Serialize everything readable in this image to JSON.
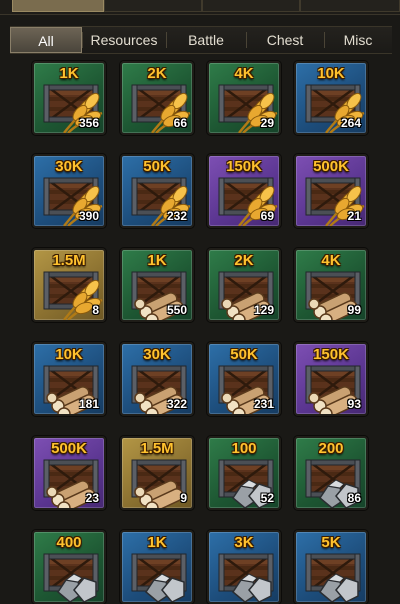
{
  "filter_tabs": [
    "All",
    "Resources",
    "Battle",
    "Chest",
    "Misc"
  ],
  "active_filter": "All",
  "rarity_colors": {
    "green": "#2f7c49",
    "blue": "#2d6fa8",
    "purple": "#7d4fb3",
    "gold": "#b39645"
  },
  "items": [
    {
      "amount": "1K",
      "count": "356",
      "rarity": "green",
      "resource": "wheat"
    },
    {
      "amount": "2K",
      "count": "66",
      "rarity": "green",
      "resource": "wheat"
    },
    {
      "amount": "4K",
      "count": "29",
      "rarity": "green",
      "resource": "wheat"
    },
    {
      "amount": "10K",
      "count": "264",
      "rarity": "blue",
      "resource": "wheat"
    },
    {
      "amount": "30K",
      "count": "390",
      "rarity": "blue",
      "resource": "wheat"
    },
    {
      "amount": "50K",
      "count": "232",
      "rarity": "blue",
      "resource": "wheat"
    },
    {
      "amount": "150K",
      "count": "69",
      "rarity": "purple",
      "resource": "wheat"
    },
    {
      "amount": "500K",
      "count": "21",
      "rarity": "purple",
      "resource": "wheat"
    },
    {
      "amount": "1.5M",
      "count": "8",
      "rarity": "gold",
      "resource": "wheat"
    },
    {
      "amount": "1K",
      "count": "550",
      "rarity": "green",
      "resource": "wood"
    },
    {
      "amount": "2K",
      "count": "129",
      "rarity": "green",
      "resource": "wood"
    },
    {
      "amount": "4K",
      "count": "99",
      "rarity": "green",
      "resource": "wood"
    },
    {
      "amount": "10K",
      "count": "181",
      "rarity": "blue",
      "resource": "wood"
    },
    {
      "amount": "30K",
      "count": "322",
      "rarity": "blue",
      "resource": "wood"
    },
    {
      "amount": "50K",
      "count": "231",
      "rarity": "blue",
      "resource": "wood"
    },
    {
      "amount": "150K",
      "count": "93",
      "rarity": "purple",
      "resource": "wood"
    },
    {
      "amount": "500K",
      "count": "23",
      "rarity": "purple",
      "resource": "wood"
    },
    {
      "amount": "1.5M",
      "count": "9",
      "rarity": "gold",
      "resource": "wood"
    },
    {
      "amount": "100",
      "count": "52",
      "rarity": "green",
      "resource": "ore"
    },
    {
      "amount": "200",
      "count": "86",
      "rarity": "green",
      "resource": "ore"
    },
    {
      "amount": "400",
      "count": "",
      "rarity": "green",
      "resource": "ore"
    },
    {
      "amount": "1K",
      "count": "",
      "rarity": "blue",
      "resource": "ore"
    },
    {
      "amount": "3K",
      "count": "",
      "rarity": "blue",
      "resource": "ore"
    },
    {
      "amount": "5K",
      "count": "",
      "rarity": "blue",
      "resource": "ore"
    }
  ]
}
